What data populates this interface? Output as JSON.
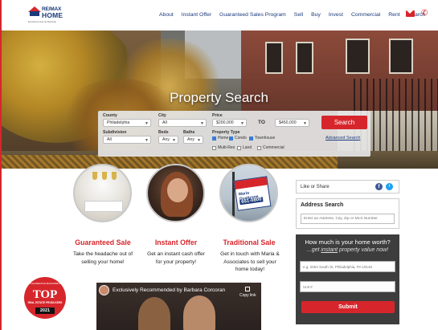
{
  "nav": {
    "logo": {
      "brand": "RE/MAX",
      "sub": "HOME",
      "tagline": "Excellence Has Its Rewards"
    },
    "items": [
      {
        "label": "About"
      },
      {
        "label": "Instant Offer"
      },
      {
        "label": "Guaranteed Sales Program"
      },
      {
        "label": "Sell"
      },
      {
        "label": "Buy"
      },
      {
        "label": "Invest"
      },
      {
        "label": "Commercial"
      },
      {
        "label": "Rent"
      },
      {
        "label": "Search"
      }
    ],
    "icons": [
      "mail-icon",
      "phone-icon"
    ],
    "accent": "#d6262c",
    "brand_color": "#1a3a7a"
  },
  "hero": {
    "title": "Property Search"
  },
  "search": {
    "county_label": "County",
    "county_value": "Philadelphia",
    "city_label": "City",
    "city_value": "All",
    "price_label": "Price",
    "price_min": "$200,000",
    "price_to": "TO",
    "price_max": "$450,000",
    "subdivision_label": "Subdivision",
    "subdivision_value": "All",
    "beds_label": "Beds",
    "beds_value": "Any",
    "baths_label": "Baths",
    "baths_value": "Any",
    "type_label": "Property Type",
    "types": [
      {
        "label": "Home",
        "checked": true
      },
      {
        "label": "Condo",
        "checked": true
      },
      {
        "label": "Townhouse",
        "checked": true
      },
      {
        "label": "Multi-Res",
        "checked": false
      },
      {
        "label": "Land",
        "checked": false
      },
      {
        "label": "Commercial",
        "checked": false
      }
    ],
    "button": "Search",
    "advanced": "Advanced Search"
  },
  "features": [
    {
      "title": "Guaranteed Sale",
      "text": "Take the headache out of selling your home!"
    },
    {
      "title": "Instant Offer",
      "text": "Get an instant cash offer for your property!"
    },
    {
      "title": "Traditional Sale",
      "text": "Get in touch with Maria & Associates to sell your home today!"
    }
  ],
  "sign": {
    "name": "Maria Quattrone",
    "phone": "651-0800"
  },
  "sidebar": {
    "share_label": "Like or Share",
    "address_title": "Address Search",
    "address_placeholder": "Enter an Address, City, Zip or MLS Number",
    "worth_title": "How much is your home worth?",
    "worth_sub_pre": "...get ",
    "worth_sub_em": "instant",
    "worth_sub_post": " property value now!",
    "street_placeholder": "e.g. 2054 South St, Philadelphia, PA 19146",
    "unit_placeholder": "Unit #",
    "submit": "Submit"
  },
  "video": {
    "title": "Exclusively Recommended by Barbara Corcoran",
    "copy": "Copy link"
  },
  "badge": {
    "top": "PHILADELPHIA MAGAZINE'S",
    "main": "TOP",
    "sub": "REAL ESTATE PRODUCERS",
    "year": "2021"
  }
}
